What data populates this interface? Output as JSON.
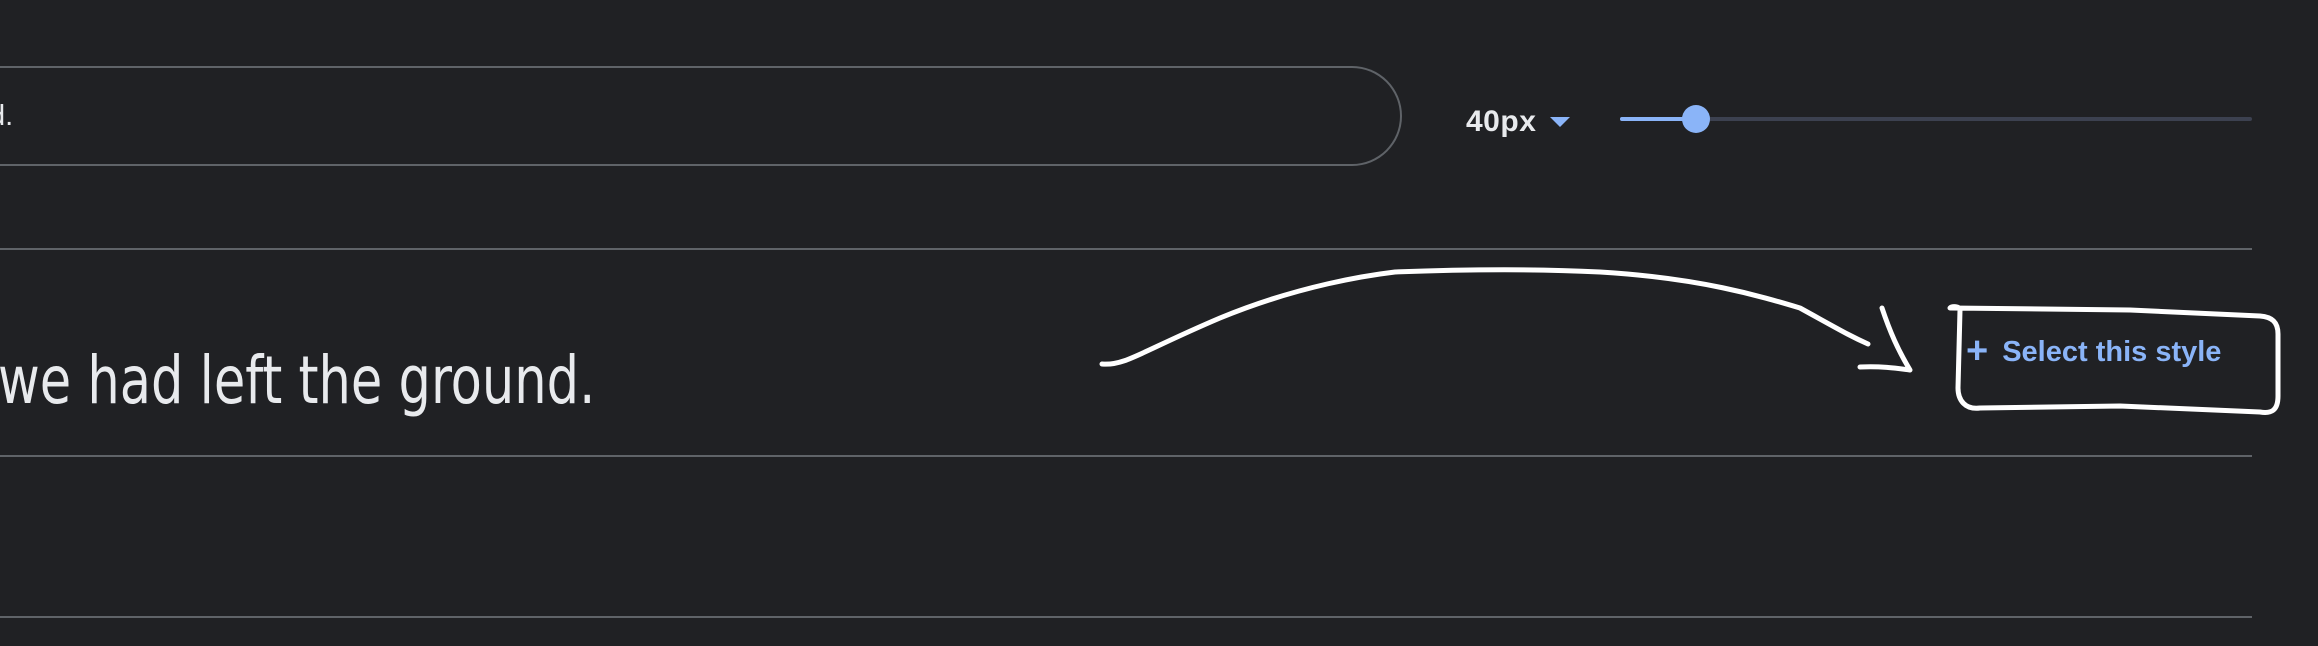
{
  "preview_input": {
    "value": "d."
  },
  "size_control": {
    "selected": "40px",
    "slider_fraction": 0.12
  },
  "sample": {
    "text": "knew it, we had left the ground."
  },
  "select_button": {
    "icon": "plus-icon",
    "label": "Select this style"
  },
  "colors": {
    "background": "#202124",
    "accent": "#8ab4f8",
    "text": "#e8eaed",
    "divider": "#5f6368",
    "annotation": "#ffffff"
  }
}
